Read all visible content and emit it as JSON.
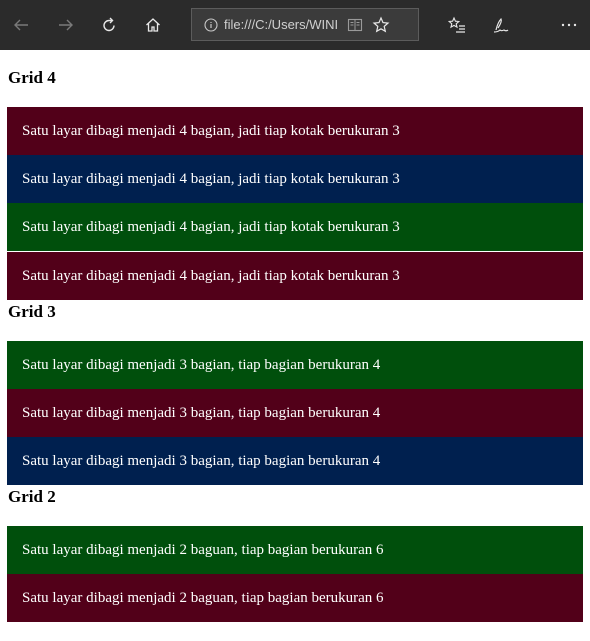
{
  "browser": {
    "address": "file:///C:/Users/WINI",
    "icons": {
      "back": "back-arrow-icon",
      "forward": "forward-arrow-icon",
      "refresh": "refresh-icon",
      "home": "home-icon",
      "info": "info-icon",
      "reading": "reading-view-icon",
      "favorite": "star-icon",
      "favorites_hub": "favorites-list-icon",
      "notes": "pen-icon",
      "more": "more-icon"
    }
  },
  "colors": {
    "maroon": "#520019",
    "navy": "#00204f",
    "green": "#004f0c",
    "toolbar": "#2b2b2b"
  },
  "sections": [
    {
      "title": "Grid 4",
      "rows": [
        {
          "text": "Satu layar dibagi menjadi 4 bagian, jadi tiap kotak berukuran 3",
          "color": "maroon"
        },
        {
          "text": "Satu layar dibagi menjadi 4 bagian, jadi tiap kotak berukuran 3",
          "color": "navy"
        },
        {
          "text": "Satu layar dibagi menjadi 4 bagian, jadi tiap kotak berukuran 3",
          "color": "green"
        },
        {
          "text": "Satu layar dibagi menjadi 4 bagian, jadi tiap kotak berukuran 3",
          "color": "maroon"
        }
      ]
    },
    {
      "title": "Grid 3",
      "rows": [
        {
          "text": "Satu layar dibagi menjadi 3 bagian, tiap bagian berukuran 4",
          "color": "green"
        },
        {
          "text": "Satu layar dibagi menjadi 3 bagian, tiap bagian berukuran 4",
          "color": "maroon"
        },
        {
          "text": "Satu layar dibagi menjadi 3 bagian, tiap bagian berukuran 4",
          "color": "navy"
        }
      ]
    },
    {
      "title": "Grid 2",
      "rows": [
        {
          "text": "Satu layar dibagi menjadi 2 baguan, tiap bagian berukuran 6",
          "color": "green"
        },
        {
          "text": "Satu layar dibagi menjadi 2 baguan, tiap bagian berukuran 6",
          "color": "maroon"
        }
      ]
    }
  ]
}
